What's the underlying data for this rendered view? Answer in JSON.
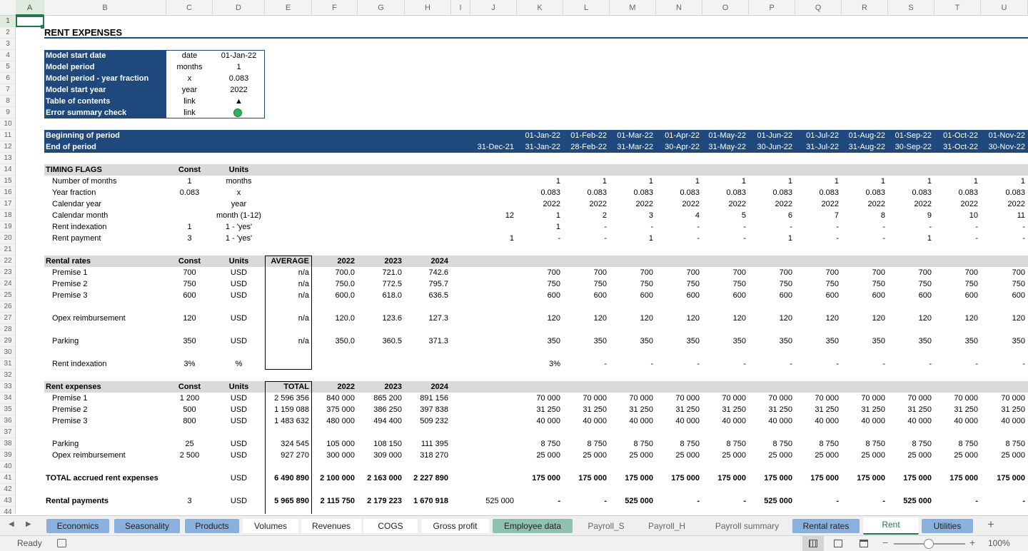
{
  "columns": [
    "A",
    "B",
    "C",
    "D",
    "E",
    "F",
    "G",
    "H",
    "I",
    "J",
    "K",
    "L",
    "M",
    "N",
    "O",
    "P",
    "Q",
    "R",
    "S",
    "T",
    "U"
  ],
  "selected_col": "A",
  "selected_row": "1",
  "title": "RENT EXPENSES",
  "info": [
    [
      "Model start date",
      "date",
      "01-Jan-22"
    ],
    [
      "Model period",
      "months",
      "1"
    ],
    [
      "Model period - year fraction",
      "x",
      "0.083"
    ],
    [
      "Model start year",
      "year",
      "2022"
    ],
    [
      "Table of contents",
      "link",
      "▲"
    ],
    [
      "Error summary check",
      "link",
      ""
    ]
  ],
  "colors": {
    "navy": "#1f497d",
    "gray_band": "#d9d9d9",
    "active_green": "#1e7a45",
    "ok_dot": "#2fb35a"
  },
  "period": {
    "begin_label": "Beginning of period",
    "end_label": "End of period",
    "J_end": "31-Dec-21",
    "begin": [
      "01-Jan-22",
      "01-Feb-22",
      "01-Mar-22",
      "01-Apr-22",
      "01-May-22",
      "01-Jun-22",
      "01-Jul-22",
      "01-Aug-22",
      "01-Sep-22",
      "01-Oct-22",
      "01-Nov-22"
    ],
    "end": [
      "31-Jan-22",
      "28-Feb-22",
      "31-Mar-22",
      "30-Apr-22",
      "31-May-22",
      "30-Jun-22",
      "31-Jul-22",
      "31-Aug-22",
      "30-Sep-22",
      "31-Oct-22",
      "30-Nov-22"
    ]
  },
  "timing": {
    "header": [
      "TIMING FLAGS",
      "Const",
      "Units"
    ],
    "rows": [
      {
        "label": "Number of months",
        "const": "1",
        "units": "months",
        "J": "",
        "vals": [
          "1",
          "1",
          "1",
          "1",
          "1",
          "1",
          "1",
          "1",
          "1",
          "1",
          "1"
        ]
      },
      {
        "label": "Year fraction",
        "const": "0.083",
        "units": "x",
        "J": "",
        "vals": [
          "0.083",
          "0.083",
          "0.083",
          "0.083",
          "0.083",
          "0.083",
          "0.083",
          "0.083",
          "0.083",
          "0.083",
          "0.083"
        ]
      },
      {
        "label": "Calendar year",
        "const": "",
        "units": "year",
        "J": "",
        "vals": [
          "2022",
          "2022",
          "2022",
          "2022",
          "2022",
          "2022",
          "2022",
          "2022",
          "2022",
          "2022",
          "2022"
        ]
      },
      {
        "label": "Calendar month",
        "const": "",
        "units": "month (1-12)",
        "J": "12",
        "vals": [
          "1",
          "2",
          "3",
          "4",
          "5",
          "6",
          "7",
          "8",
          "9",
          "10",
          "11"
        ]
      },
      {
        "label": "Rent indexation",
        "const": "1",
        "units": "1 - 'yes'",
        "J": "",
        "vals": [
          "1",
          "-",
          "-",
          "-",
          "-",
          "-",
          "-",
          "-",
          "-",
          "-",
          "-"
        ]
      },
      {
        "label": "Rent payment",
        "const": "3",
        "units": "1 - 'yes'",
        "J": "1",
        "vals": [
          "-",
          "-",
          "1",
          "-",
          "-",
          "1",
          "-",
          "-",
          "1",
          "-",
          "-"
        ]
      }
    ]
  },
  "rates": {
    "header": [
      "Rental rates",
      "Const",
      "Units",
      "AVERAGE",
      "2022",
      "2023",
      "2024"
    ],
    "rows": [
      {
        "row": "23",
        "label": "Premise 1",
        "const": "700",
        "units": "USD",
        "E": "n/a",
        "F": "700.0",
        "G": "721.0",
        "H": "742.6",
        "vals": [
          "700",
          "700",
          "700",
          "700",
          "700",
          "700",
          "700",
          "700",
          "700",
          "700",
          "700"
        ]
      },
      {
        "row": "24",
        "label": "Premise 2",
        "const": "750",
        "units": "USD",
        "E": "n/a",
        "F": "750.0",
        "G": "772.5",
        "H": "795.7",
        "vals": [
          "750",
          "750",
          "750",
          "750",
          "750",
          "750",
          "750",
          "750",
          "750",
          "750",
          "750"
        ]
      },
      {
        "row": "25",
        "label": "Premise 3",
        "const": "600",
        "units": "USD",
        "E": "n/a",
        "F": "600.0",
        "G": "618.0",
        "H": "636.5",
        "vals": [
          "600",
          "600",
          "600",
          "600",
          "600",
          "600",
          "600",
          "600",
          "600",
          "600",
          "600"
        ]
      },
      {
        "row": "27",
        "label": "Opex reimbursement",
        "const": "120",
        "units": "USD",
        "E": "n/a",
        "F": "120.0",
        "G": "123.6",
        "H": "127.3",
        "vals": [
          "120",
          "120",
          "120",
          "120",
          "120",
          "120",
          "120",
          "120",
          "120",
          "120",
          "120"
        ]
      },
      {
        "row": "29",
        "label": "Parking",
        "const": "350",
        "units": "USD",
        "E": "n/a",
        "F": "350.0",
        "G": "360.5",
        "H": "371.3",
        "vals": [
          "350",
          "350",
          "350",
          "350",
          "350",
          "350",
          "350",
          "350",
          "350",
          "350",
          "350"
        ]
      },
      {
        "row": "31",
        "label": "Rent indexation",
        "const": "3%",
        "units": "%",
        "E": "",
        "F": "",
        "G": "",
        "H": "",
        "vals": [
          "3%",
          "-",
          "-",
          "-",
          "-",
          "-",
          "-",
          "-",
          "-",
          "-",
          "-"
        ]
      }
    ]
  },
  "expenses": {
    "header": [
      "Rent expenses",
      "Const",
      "Units",
      "TOTAL",
      "2022",
      "2023",
      "2024"
    ],
    "rows": [
      {
        "row": "34",
        "label": "Premise 1",
        "const": "1 200",
        "units": "USD",
        "E": "2 596 356",
        "F": "840 000",
        "G": "865 200",
        "H": "891 156",
        "J": "",
        "vals": [
          "70 000",
          "70 000",
          "70 000",
          "70 000",
          "70 000",
          "70 000",
          "70 000",
          "70 000",
          "70 000",
          "70 000",
          "70 000"
        ],
        "bold": false
      },
      {
        "row": "35",
        "label": "Premise 2",
        "const": "500",
        "units": "USD",
        "E": "1 159 088",
        "F": "375 000",
        "G": "386 250",
        "H": "397 838",
        "J": "",
        "vals": [
          "31 250",
          "31 250",
          "31 250",
          "31 250",
          "31 250",
          "31 250",
          "31 250",
          "31 250",
          "31 250",
          "31 250",
          "31 250"
        ],
        "bold": false
      },
      {
        "row": "36",
        "label": "Premise 3",
        "const": "800",
        "units": "USD",
        "E": "1 483 632",
        "F": "480 000",
        "G": "494 400",
        "H": "509 232",
        "J": "",
        "vals": [
          "40 000",
          "40 000",
          "40 000",
          "40 000",
          "40 000",
          "40 000",
          "40 000",
          "40 000",
          "40 000",
          "40 000",
          "40 000"
        ],
        "bold": false
      },
      {
        "row": "38",
        "label": "Parking",
        "const": "25",
        "units": "USD",
        "E": "324 545",
        "F": "105 000",
        "G": "108 150",
        "H": "111 395",
        "J": "",
        "vals": [
          "8 750",
          "8 750",
          "8 750",
          "8 750",
          "8 750",
          "8 750",
          "8 750",
          "8 750",
          "8 750",
          "8 750",
          "8 750"
        ],
        "bold": false
      },
      {
        "row": "39",
        "label": "Opex reimbursement",
        "const": "2 500",
        "units": "USD",
        "E": "927 270",
        "F": "300 000",
        "G": "309 000",
        "H": "318 270",
        "J": "",
        "vals": [
          "25 000",
          "25 000",
          "25 000",
          "25 000",
          "25 000",
          "25 000",
          "25 000",
          "25 000",
          "25 000",
          "25 000",
          "25 000"
        ],
        "bold": false
      },
      {
        "row": "41",
        "label": "TOTAL accrued rent expenses",
        "const": "",
        "units": "USD",
        "E": "6 490 890",
        "F": "2 100 000",
        "G": "2 163 000",
        "H": "2 227 890",
        "J": "",
        "vals": [
          "175 000",
          "175 000",
          "175 000",
          "175 000",
          "175 000",
          "175 000",
          "175 000",
          "175 000",
          "175 000",
          "175 000",
          "175 000"
        ],
        "bold": true
      },
      {
        "row": "43",
        "label": "Rental payments",
        "const": "3",
        "units": "USD",
        "E": "5 965 890",
        "F": "2 115 750",
        "G": "2 179 223",
        "H": "1 670 918",
        "J": "525 000",
        "vals": [
          "-",
          "-",
          "525 000",
          "-",
          "-",
          "525 000",
          "-",
          "-",
          "525 000",
          "-",
          "-"
        ],
        "bold": true
      }
    ]
  },
  "sheet_tabs": [
    {
      "label": "Economics",
      "style": "blue"
    },
    {
      "label": "Seasonality",
      "style": "blue"
    },
    {
      "label": "Products",
      "style": "blue"
    },
    {
      "label": "Volumes",
      "style": "white"
    },
    {
      "label": "Revenues",
      "style": "white"
    },
    {
      "label": "COGS",
      "style": "white"
    },
    {
      "label": "Gross profit",
      "style": "white"
    },
    {
      "label": "Employee data",
      "style": "teal"
    },
    {
      "label": "Payroll_S",
      "style": "plain"
    },
    {
      "label": "Payroll_H",
      "style": "plain"
    },
    {
      "label": "Payroll summary",
      "style": "plain"
    },
    {
      "label": "Rental rates",
      "style": "blue"
    },
    {
      "label": "Rent",
      "style": "active"
    },
    {
      "label": "Utilities",
      "style": "blue"
    }
  ],
  "status": {
    "ready": "Ready",
    "zoom": "100%"
  },
  "icons": {
    "prev": "◀",
    "next": "▶",
    "add": "+",
    "minus": "−",
    "plus": "+"
  }
}
